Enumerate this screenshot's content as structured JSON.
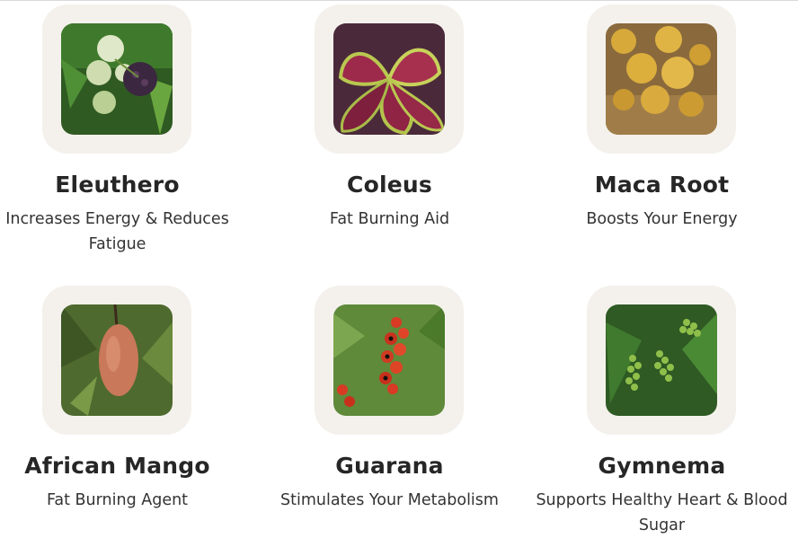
{
  "ingredients": [
    {
      "name": "Eleuthero",
      "desc_line1": "Increases Energy & Reduces",
      "desc_line2": "Fatigue",
      "image": "eleuthero-plant-photo"
    },
    {
      "name": "Coleus",
      "desc_line1": "Fat Burning Aid",
      "desc_line2": "",
      "image": "coleus-leaves-photo"
    },
    {
      "name": "Maca Root",
      "desc_line1": "Boosts Your Energy",
      "desc_line2": "",
      "image": "maca-roots-photo"
    },
    {
      "name": "African Mango",
      "desc_line1": "Fat Burning Agent",
      "desc_line2": "",
      "image": "african-mango-fruit-photo"
    },
    {
      "name": "Guarana",
      "desc_line1": "Stimulates Your Metabolism",
      "desc_line2": "",
      "image": "guarana-berries-photo"
    },
    {
      "name": "Gymnema",
      "desc_line1": "Supports Healthy Heart & Blood",
      "desc_line2": "Sugar",
      "image": "gymnema-berries-photo"
    }
  ],
  "colors": {
    "frame": "#f4f1ec",
    "text": "#262626"
  }
}
